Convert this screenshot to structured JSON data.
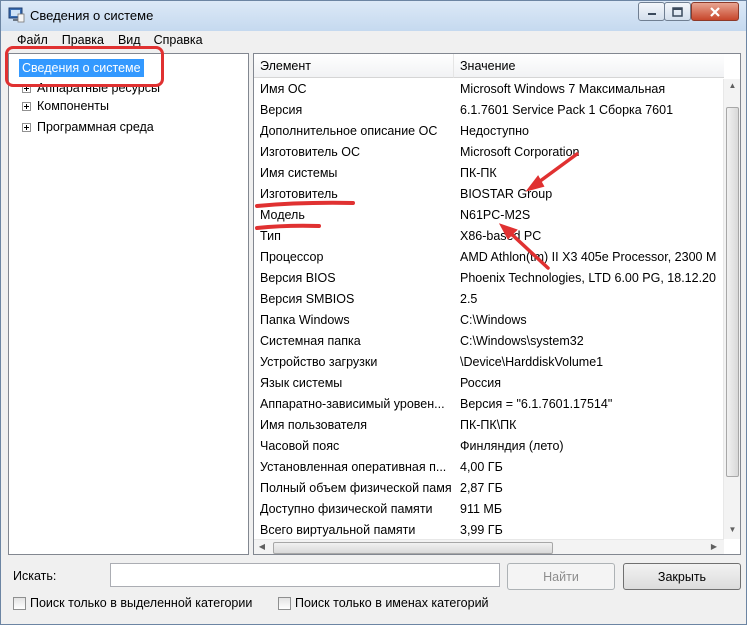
{
  "window": {
    "title": "Сведения о системе",
    "accent": "#3399ff",
    "annotation_color": "#e03131"
  },
  "menu": [
    "Файл",
    "Правка",
    "Вид",
    "Справка"
  ],
  "tree": {
    "root": "Сведения о системе",
    "children": [
      "Аппаратные ресурсы",
      "Компоненты",
      "Программная среда"
    ]
  },
  "table": {
    "headers": {
      "element": "Элемент",
      "value": "Значение"
    },
    "rows": [
      {
        "element": "Имя ОС",
        "value": "Microsoft Windows 7 Максимальная"
      },
      {
        "element": "Версия",
        "value": "6.1.7601 Service Pack 1 Сборка 7601"
      },
      {
        "element": "Дополнительное описание ОС",
        "value": "Недоступно"
      },
      {
        "element": "Изготовитель ОС",
        "value": "Microsoft Corporation"
      },
      {
        "element": "Имя системы",
        "value": "ПК-ПК"
      },
      {
        "element": "Изготовитель",
        "value": "BIOSTAR Group"
      },
      {
        "element": "Модель",
        "value": "N61PC-M2S"
      },
      {
        "element": "Тип",
        "value": "X86-based PC"
      },
      {
        "element": "Процессор",
        "value": "AMD Athlon(tm) II X3 405e Processor, 2300 М"
      },
      {
        "element": "Версия BIOS",
        "value": "Phoenix Technologies, LTD 6.00 PG, 18.12.20"
      },
      {
        "element": "Версия SMBIOS",
        "value": "2.5"
      },
      {
        "element": "Папка Windows",
        "value": "C:\\Windows"
      },
      {
        "element": "Системная папка",
        "value": "C:\\Windows\\system32"
      },
      {
        "element": "Устройство загрузки",
        "value": "\\Device\\HarddiskVolume1"
      },
      {
        "element": "Язык системы",
        "value": "Россия"
      },
      {
        "element": "Аппаратно-зависимый уровен...",
        "value": "Версия = \"6.1.7601.17514\""
      },
      {
        "element": "Имя пользователя",
        "value": "ПК-ПК\\ПК"
      },
      {
        "element": "Часовой пояс",
        "value": "Финляндия (лето)"
      },
      {
        "element": "Установленная оперативная п...",
        "value": "4,00 ГБ"
      },
      {
        "element": "Полный объем физической памя...",
        "value": "2,87 ГБ"
      },
      {
        "element": "Доступно физической памяти",
        "value": "911 МБ"
      },
      {
        "element": "Всего виртуальной памяти",
        "value": "3,99 ГБ"
      }
    ]
  },
  "search": {
    "label": "Искать:",
    "value": "",
    "find_button": "Найти",
    "close_button": "Закрыть",
    "checkbox_selected_category": "Поиск только в выделенной категории",
    "checkbox_category_names": "Поиск только в именах категорий"
  }
}
